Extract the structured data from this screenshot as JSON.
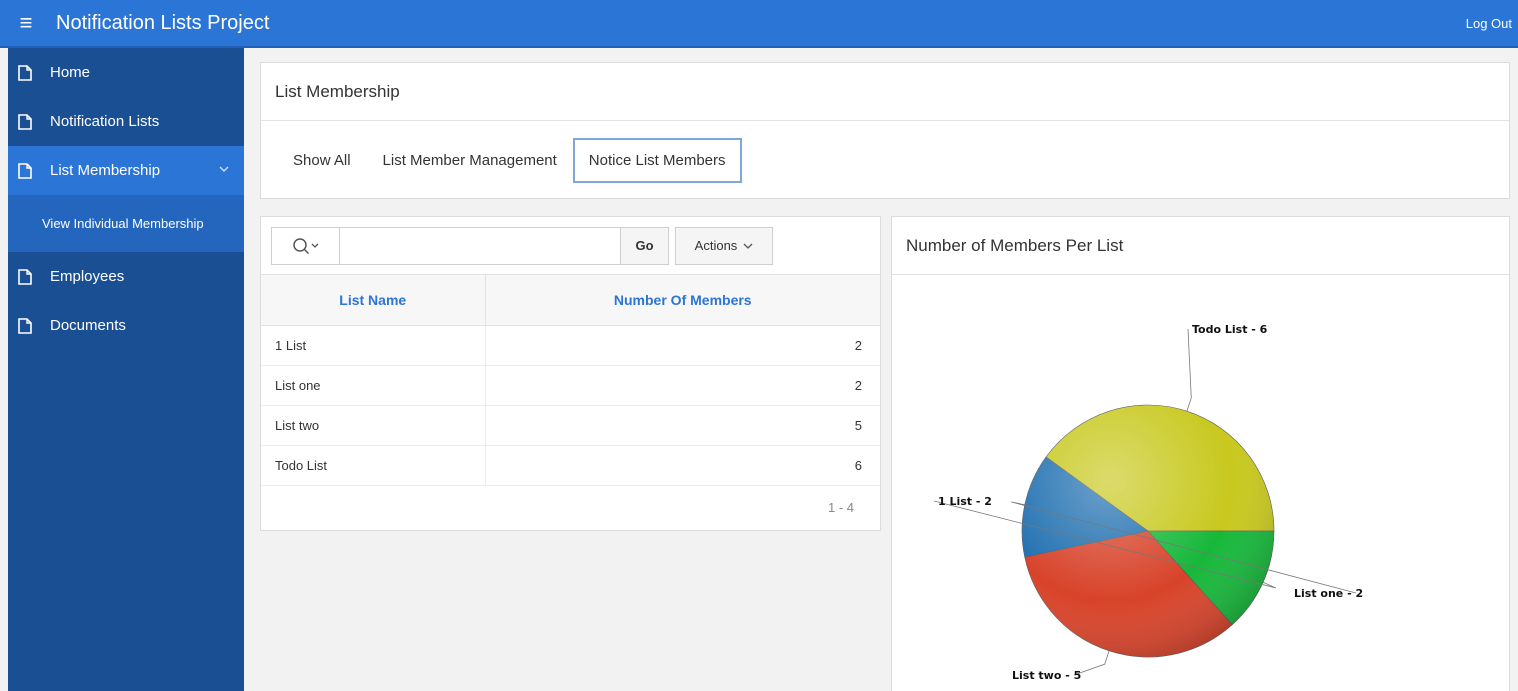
{
  "header": {
    "menu_icon": "hamburger-icon",
    "app_title": "Notification Lists Project",
    "logout_label": "Log Out"
  },
  "sidebar": {
    "items": [
      {
        "label": "Home",
        "icon": "page-icon"
      },
      {
        "label": "Notification Lists",
        "icon": "page-icon"
      },
      {
        "label": "List Membership",
        "icon": "page-icon",
        "active": true
      },
      {
        "label": "View Individual Membership",
        "sub": true
      },
      {
        "label": "Employees",
        "icon": "page-icon"
      },
      {
        "label": "Documents",
        "icon": "page-icon"
      }
    ]
  },
  "membership_region": {
    "title": "List Membership",
    "tabs": [
      {
        "label": "Show All"
      },
      {
        "label": "List Member Management"
      },
      {
        "label": "Notice List Members",
        "active": true
      }
    ]
  },
  "report": {
    "search_value": "",
    "go_label": "Go",
    "actions_label": "Actions",
    "columns": [
      "List Name",
      "Number Of Members"
    ],
    "rows": [
      {
        "name": "1 List",
        "count": "2"
      },
      {
        "name": "List one",
        "count": "2"
      },
      {
        "name": "List two",
        "count": "5"
      },
      {
        "name": "Todo List",
        "count": "6"
      }
    ],
    "pagination": "1 - 4"
  },
  "chart_region": {
    "title": "Number of Members Per List"
  },
  "chart_data": {
    "type": "pie",
    "categories": [
      "Todo List",
      "List one",
      "List two",
      "1 List"
    ],
    "values": [
      6,
      2,
      5,
      2
    ],
    "slice_labels": [
      "Todo List - 6",
      "List one - 2",
      "List two - 5",
      "1 List - 2"
    ],
    "colors": [
      "#c8c81e",
      "#1f6fb0",
      "#d8432a",
      "#16b83a"
    ],
    "legend": "none"
  },
  "colors": {
    "header_blue": "#2b75d6",
    "sidebar_blue": "#1b4f93",
    "link_blue": "#2b75d6"
  }
}
